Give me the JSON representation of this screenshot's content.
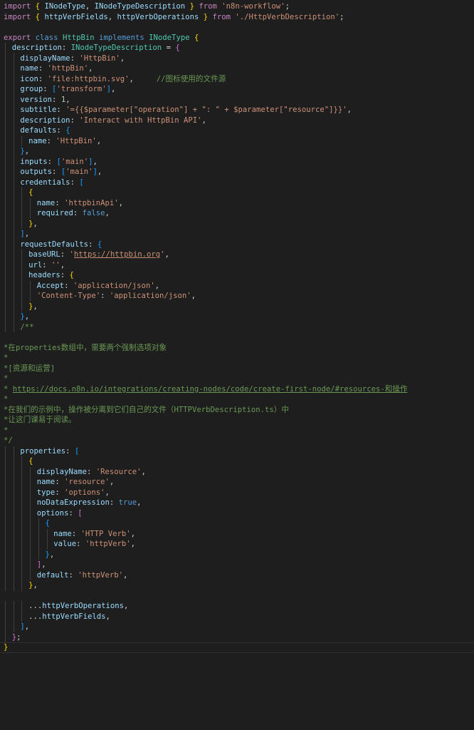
{
  "editor": {
    "language": "typescript",
    "theme_background": "#1e1e1e",
    "colors": {
      "keyword": "#c586c0",
      "storage": "#569cd6",
      "type": "#4ec9b0",
      "property": "#9cdcfe",
      "string": "#ce9178",
      "number": "#b5cea8",
      "comment": "#6a9955",
      "bracket_1": "#ffd700",
      "bracket_2": "#da70d6",
      "bracket_3": "#179fff"
    },
    "lines": [
      {
        "indent": 0,
        "tokens": [
          [
            "kw",
            "import"
          ],
          [
            "pun",
            " "
          ],
          [
            "b1",
            "{"
          ],
          [
            "pun",
            " "
          ],
          [
            "var",
            "INodeType"
          ],
          [
            "pun",
            ", "
          ],
          [
            "var",
            "INodeTypeDescription"
          ],
          [
            "pun",
            " "
          ],
          [
            "b1",
            "}"
          ],
          [
            "pun",
            " "
          ],
          [
            "kw",
            "from"
          ],
          [
            "pun",
            " "
          ],
          [
            "str",
            "'n8n-workflow'"
          ],
          [
            "pun",
            ";"
          ]
        ]
      },
      {
        "indent": 0,
        "tokens": [
          [
            "kw",
            "import"
          ],
          [
            "pun",
            " "
          ],
          [
            "b1",
            "{"
          ],
          [
            "pun",
            " "
          ],
          [
            "var",
            "httpVerbFields"
          ],
          [
            "pun",
            ", "
          ],
          [
            "var",
            "httpVerbOperations"
          ],
          [
            "pun",
            " "
          ],
          [
            "b1",
            "}"
          ],
          [
            "pun",
            " "
          ],
          [
            "kw",
            "from"
          ],
          [
            "pun",
            " "
          ],
          [
            "str",
            "'./HttpVerbDescription'"
          ],
          [
            "pun",
            ";"
          ]
        ]
      },
      {
        "indent": 0,
        "tokens": []
      },
      {
        "indent": 0,
        "tokens": [
          [
            "kw",
            "export"
          ],
          [
            "pun",
            " "
          ],
          [
            "kw2",
            "class"
          ],
          [
            "pun",
            " "
          ],
          [
            "cls",
            "HttpBin"
          ],
          [
            "pun",
            " "
          ],
          [
            "kw2",
            "implements"
          ],
          [
            "pun",
            " "
          ],
          [
            "cls",
            "INodeType"
          ],
          [
            "pun",
            " "
          ],
          [
            "b1",
            "{"
          ]
        ]
      },
      {
        "indent": 1,
        "tokens": [
          [
            "var",
            "description"
          ],
          [
            "pun",
            ": "
          ],
          [
            "cls",
            "INodeTypeDescription"
          ],
          [
            "pun",
            " = "
          ],
          [
            "b2",
            "{"
          ]
        ]
      },
      {
        "indent": 2,
        "tokens": [
          [
            "var",
            "displayName"
          ],
          [
            "pun",
            ": "
          ],
          [
            "str",
            "'HttpBin'"
          ],
          [
            "pun",
            ","
          ]
        ]
      },
      {
        "indent": 2,
        "tokens": [
          [
            "var",
            "name"
          ],
          [
            "pun",
            ": "
          ],
          [
            "str",
            "'httpBin'"
          ],
          [
            "pun",
            ","
          ]
        ]
      },
      {
        "indent": 2,
        "tokens": [
          [
            "var",
            "icon"
          ],
          [
            "pun",
            ": "
          ],
          [
            "str",
            "'file:httpbin.svg'"
          ],
          [
            "pun",
            ",     "
          ],
          [
            "cmt",
            "//图标使用的文件源"
          ]
        ]
      },
      {
        "indent": 2,
        "tokens": [
          [
            "var",
            "group"
          ],
          [
            "pun",
            ": "
          ],
          [
            "b3",
            "["
          ],
          [
            "str",
            "'transform'"
          ],
          [
            "b3",
            "]"
          ],
          [
            "pun",
            ","
          ]
        ]
      },
      {
        "indent": 2,
        "tokens": [
          [
            "var",
            "version"
          ],
          [
            "pun",
            ": "
          ],
          [
            "num",
            "1"
          ],
          [
            "pun",
            ","
          ]
        ]
      },
      {
        "indent": 2,
        "tokens": [
          [
            "var",
            "subtitle"
          ],
          [
            "pun",
            ": "
          ],
          [
            "str",
            "'={{$parameter[\"operation\"] + \": \" + $parameter[\"resource\"]}}'"
          ],
          [
            "pun",
            ","
          ]
        ]
      },
      {
        "indent": 2,
        "tokens": [
          [
            "var",
            "description"
          ],
          [
            "pun",
            ": "
          ],
          [
            "str",
            "'Interact with HttpBin API'"
          ],
          [
            "pun",
            ","
          ]
        ]
      },
      {
        "indent": 2,
        "tokens": [
          [
            "var",
            "defaults"
          ],
          [
            "pun",
            ": "
          ],
          [
            "b3",
            "{"
          ]
        ]
      },
      {
        "indent": 3,
        "tokens": [
          [
            "var",
            "name"
          ],
          [
            "pun",
            ": "
          ],
          [
            "str",
            "'HttpBin'"
          ],
          [
            "pun",
            ","
          ]
        ]
      },
      {
        "indent": 2,
        "tokens": [
          [
            "b3",
            "}"
          ],
          [
            "pun",
            ","
          ]
        ]
      },
      {
        "indent": 2,
        "tokens": [
          [
            "var",
            "inputs"
          ],
          [
            "pun",
            ": "
          ],
          [
            "b3",
            "["
          ],
          [
            "str",
            "'main'"
          ],
          [
            "b3",
            "]"
          ],
          [
            "pun",
            ","
          ]
        ]
      },
      {
        "indent": 2,
        "tokens": [
          [
            "var",
            "outputs"
          ],
          [
            "pun",
            ": "
          ],
          [
            "b3",
            "["
          ],
          [
            "str",
            "'main'"
          ],
          [
            "b3",
            "]"
          ],
          [
            "pun",
            ","
          ]
        ]
      },
      {
        "indent": 2,
        "tokens": [
          [
            "var",
            "credentials"
          ],
          [
            "pun",
            ": "
          ],
          [
            "b3",
            "["
          ]
        ]
      },
      {
        "indent": 3,
        "tokens": [
          [
            "b1",
            "{"
          ]
        ]
      },
      {
        "indent": 4,
        "tokens": [
          [
            "var",
            "name"
          ],
          [
            "pun",
            ": "
          ],
          [
            "str",
            "'httpbinApi'"
          ],
          [
            "pun",
            ","
          ]
        ]
      },
      {
        "indent": 4,
        "tokens": [
          [
            "var",
            "required"
          ],
          [
            "pun",
            ": "
          ],
          [
            "bool",
            "false"
          ],
          [
            "pun",
            ","
          ]
        ]
      },
      {
        "indent": 3,
        "tokens": [
          [
            "b1",
            "}"
          ],
          [
            "pun",
            ","
          ]
        ]
      },
      {
        "indent": 2,
        "tokens": [
          [
            "b3",
            "]"
          ],
          [
            "pun",
            ","
          ]
        ]
      },
      {
        "indent": 2,
        "tokens": [
          [
            "var",
            "requestDefaults"
          ],
          [
            "pun",
            ": "
          ],
          [
            "b3",
            "{"
          ]
        ]
      },
      {
        "indent": 3,
        "tokens": [
          [
            "var",
            "baseURL"
          ],
          [
            "pun",
            ": "
          ],
          [
            "str",
            "'"
          ],
          [
            "str link",
            "https://httpbin.org"
          ],
          [
            "str",
            "'"
          ],
          [
            "pun",
            ","
          ]
        ]
      },
      {
        "indent": 3,
        "tokens": [
          [
            "var",
            "url"
          ],
          [
            "pun",
            ": "
          ],
          [
            "str",
            "''"
          ],
          [
            "pun",
            ","
          ]
        ]
      },
      {
        "indent": 3,
        "tokens": [
          [
            "var",
            "headers"
          ],
          [
            "pun",
            ": "
          ],
          [
            "b1",
            "{"
          ]
        ]
      },
      {
        "indent": 4,
        "tokens": [
          [
            "var",
            "Accept"
          ],
          [
            "pun",
            ": "
          ],
          [
            "str",
            "'application/json'"
          ],
          [
            "pun",
            ","
          ]
        ]
      },
      {
        "indent": 4,
        "tokens": [
          [
            "str",
            "'Content-Type'"
          ],
          [
            "pun",
            ": "
          ],
          [
            "str",
            "'application/json'"
          ],
          [
            "pun",
            ","
          ]
        ]
      },
      {
        "indent": 3,
        "tokens": [
          [
            "b1",
            "}"
          ],
          [
            "pun",
            ","
          ]
        ]
      },
      {
        "indent": 2,
        "tokens": [
          [
            "b3",
            "}"
          ],
          [
            "pun",
            ","
          ]
        ]
      },
      {
        "indent": 2,
        "tokens": [
          [
            "cmt",
            "/**"
          ]
        ]
      },
      {
        "indent": 0,
        "tokens": []
      },
      {
        "indent": 0,
        "tokens": [
          [
            "cmt",
            "*在properties数组中，需要两个强制选项对象"
          ]
        ]
      },
      {
        "indent": 0,
        "tokens": [
          [
            "cmt",
            "*"
          ]
        ]
      },
      {
        "indent": 0,
        "tokens": [
          [
            "cmt",
            "*[资源和运营]"
          ]
        ]
      },
      {
        "indent": 0,
        "tokens": [
          [
            "cmt",
            "*"
          ]
        ]
      },
      {
        "indent": 0,
        "tokens": [
          [
            "cmt",
            "* "
          ],
          [
            "cmt link",
            "https://docs.n8n.io/integrations/creating-nodes/code/create-first-node/#resources-和操作"
          ]
        ]
      },
      {
        "indent": 0,
        "tokens": [
          [
            "cmt",
            "*"
          ]
        ]
      },
      {
        "indent": 0,
        "tokens": [
          [
            "cmt",
            "*在我们的示例中，操作被分离到它们自己的文件（HTTPVerbDescription.ts）中"
          ]
        ]
      },
      {
        "indent": 0,
        "tokens": [
          [
            "cmt",
            "*让这门课易于阅读。"
          ]
        ]
      },
      {
        "indent": 0,
        "tokens": [
          [
            "cmt",
            "*"
          ]
        ]
      },
      {
        "indent": 0,
        "tokens": [
          [
            "cmt",
            "*/"
          ]
        ]
      },
      {
        "indent": 2,
        "tokens": [
          [
            "var",
            "properties"
          ],
          [
            "pun",
            ": "
          ],
          [
            "b3",
            "["
          ]
        ]
      },
      {
        "indent": 3,
        "tokens": [
          [
            "b1",
            "{"
          ]
        ]
      },
      {
        "indent": 4,
        "tokens": [
          [
            "var",
            "displayName"
          ],
          [
            "pun",
            ": "
          ],
          [
            "str",
            "'Resource'"
          ],
          [
            "pun",
            ","
          ]
        ]
      },
      {
        "indent": 4,
        "tokens": [
          [
            "var",
            "name"
          ],
          [
            "pun",
            ": "
          ],
          [
            "str",
            "'resource'"
          ],
          [
            "pun",
            ","
          ]
        ]
      },
      {
        "indent": 4,
        "tokens": [
          [
            "var",
            "type"
          ],
          [
            "pun",
            ": "
          ],
          [
            "str",
            "'options'"
          ],
          [
            "pun",
            ","
          ]
        ]
      },
      {
        "indent": 4,
        "tokens": [
          [
            "var",
            "noDataExpression"
          ],
          [
            "pun",
            ": "
          ],
          [
            "bool",
            "true"
          ],
          [
            "pun",
            ","
          ]
        ]
      },
      {
        "indent": 4,
        "tokens": [
          [
            "var",
            "options"
          ],
          [
            "pun",
            ": "
          ],
          [
            "b2",
            "["
          ]
        ]
      },
      {
        "indent": 5,
        "tokens": [
          [
            "b3",
            "{"
          ]
        ]
      },
      {
        "indent": 6,
        "tokens": [
          [
            "var",
            "name"
          ],
          [
            "pun",
            ": "
          ],
          [
            "str",
            "'HTTP Verb'"
          ],
          [
            "pun",
            ","
          ]
        ]
      },
      {
        "indent": 6,
        "tokens": [
          [
            "var",
            "value"
          ],
          [
            "pun",
            ": "
          ],
          [
            "str",
            "'httpVerb'"
          ],
          [
            "pun",
            ","
          ]
        ]
      },
      {
        "indent": 5,
        "tokens": [
          [
            "b3",
            "}"
          ],
          [
            "pun",
            ","
          ]
        ]
      },
      {
        "indent": 4,
        "tokens": [
          [
            "b2",
            "]"
          ],
          [
            "pun",
            ","
          ]
        ]
      },
      {
        "indent": 4,
        "tokens": [
          [
            "var",
            "default"
          ],
          [
            "pun",
            ": "
          ],
          [
            "str",
            "'httpVerb'"
          ],
          [
            "pun",
            ","
          ]
        ]
      },
      {
        "indent": 3,
        "tokens": [
          [
            "b1",
            "}"
          ],
          [
            "pun",
            ","
          ]
        ]
      },
      {
        "indent": 0,
        "tokens": []
      },
      {
        "indent": 3,
        "tokens": [
          [
            "pun",
            "..."
          ],
          [
            "var",
            "httpVerbOperations"
          ],
          [
            "pun",
            ","
          ]
        ]
      },
      {
        "indent": 3,
        "tokens": [
          [
            "pun",
            "..."
          ],
          [
            "var",
            "httpVerbFields"
          ],
          [
            "pun",
            ","
          ]
        ]
      },
      {
        "indent": 2,
        "tokens": [
          [
            "b3",
            "]"
          ],
          [
            "pun",
            ","
          ]
        ]
      },
      {
        "indent": 1,
        "tokens": [
          [
            "b2",
            "}"
          ],
          [
            "pun",
            ";"
          ]
        ]
      },
      {
        "indent": 0,
        "current": true,
        "tokens": [
          [
            "b1",
            "}"
          ]
        ]
      }
    ]
  }
}
